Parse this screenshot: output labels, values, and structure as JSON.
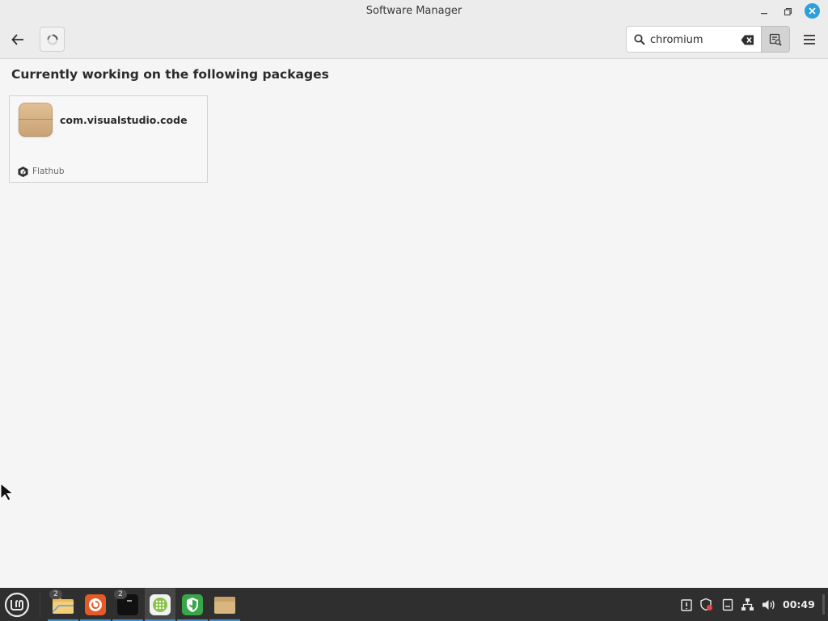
{
  "window": {
    "title": "Software Manager"
  },
  "search": {
    "value": "chromium",
    "placeholder": ""
  },
  "main": {
    "heading": "Currently working on the following packages",
    "packages": [
      {
        "name": "com.visualstudio.code",
        "source": "Flathub"
      }
    ]
  },
  "taskbar": {
    "apps": [
      {
        "name": "file-manager",
        "badge": "2"
      },
      {
        "name": "firefox",
        "badge": ""
      },
      {
        "name": "terminal",
        "badge": "2"
      },
      {
        "name": "software-manager",
        "badge": ""
      },
      {
        "name": "update-manager",
        "badge": ""
      },
      {
        "name": "files-folder",
        "badge": ""
      }
    ],
    "clock": "00:49"
  },
  "colors": {
    "accent": "#2d9fd9",
    "taskbar": "#2f2f2f",
    "mint_green": "#8bc34a"
  }
}
